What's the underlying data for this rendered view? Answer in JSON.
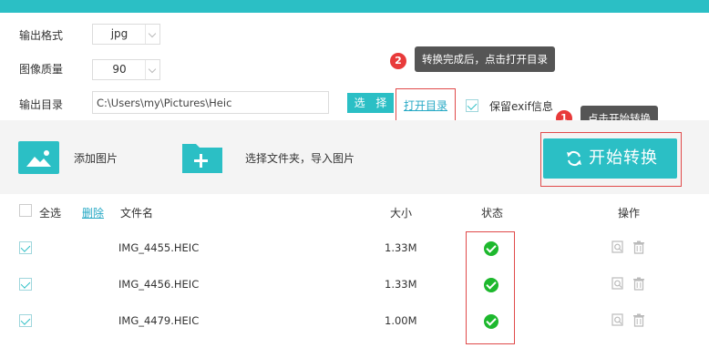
{
  "settings": {
    "format_label": "输出格式",
    "format_value": "jpg",
    "quality_label": "图像质量",
    "quality_value": "90",
    "dir_label": "输出目录",
    "dir_value": "C:\\Users\\my\\Pictures\\Heic",
    "select_button": "选 择",
    "open_dir_link": "打开目录",
    "exif_label": "保留exif信息",
    "exif_checked": true
  },
  "tips": {
    "tip1_num": "1",
    "tip1_text": "点击开始转换",
    "tip2_num": "2",
    "tip2_text": "转换完成后，点击打开目录"
  },
  "actions": {
    "add_image": "添加图片",
    "add_folder": "选择文件夹，导入图片",
    "start_button": "开始转换",
    "add_image_icon": "image-icon",
    "add_folder_icon": "folder-plus-icon",
    "start_icon": "refresh-icon"
  },
  "table": {
    "select_all": "全选",
    "delete": "删除",
    "col_name": "文件名",
    "col_size": "大小",
    "col_status": "状态",
    "col_ops": "操作",
    "rows": [
      {
        "name": "IMG_4455.HEIC",
        "size": "1.33M",
        "status": "done",
        "checked": true
      },
      {
        "name": "IMG_4456.HEIC",
        "size": "1.33M",
        "status": "done",
        "checked": true
      },
      {
        "name": "IMG_4479.HEIC",
        "size": "1.00M",
        "status": "done",
        "checked": true
      }
    ]
  },
  "colors": {
    "accent": "#2bbfc5",
    "highlight_border": "#e04a4a",
    "success": "#1db82d",
    "link": "#27a9c5"
  }
}
